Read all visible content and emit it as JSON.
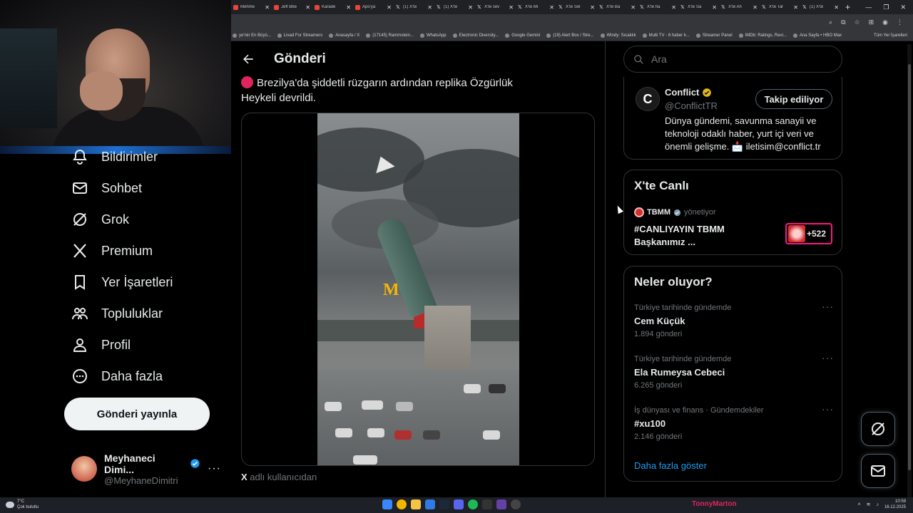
{
  "browser": {
    "tabs": [
      {
        "label": "Mehme",
        "icon": "youtube"
      },
      {
        "label": "Jeff Bbe",
        "icon": "youtube"
      },
      {
        "label": "Karade",
        "icon": "youtube"
      },
      {
        "label": "Apo'ya",
        "icon": "youtube"
      },
      {
        "label": "(1) X'te",
        "icon": "x"
      },
      {
        "label": "(1) X'te",
        "icon": "x"
      },
      {
        "label": "X'te sev",
        "icon": "x"
      },
      {
        "label": "X'te Mi",
        "icon": "x"
      },
      {
        "label": "X'te Sel",
        "icon": "x"
      },
      {
        "label": "X'te Ba",
        "icon": "x"
      },
      {
        "label": "X'te ha",
        "icon": "x"
      },
      {
        "label": "X'te Sa",
        "icon": "x"
      },
      {
        "label": "X'te Ah",
        "icon": "x"
      },
      {
        "label": "X'te Tar",
        "icon": "x"
      },
      {
        "label": "(1) X'te",
        "icon": "x"
      }
    ],
    "bookmarks": [
      "ye'nin En Büyü...",
      "Livad For Streamers",
      "Anasayfa / X",
      "(17145) Rammstein...",
      "WhatsApp",
      "Electronic Diversity...",
      "Google Gemini",
      "(19) Alert Box / Stre...",
      "Windy: Sıcaklık",
      "Multi TV - 6 haber k...",
      "Streamer Panel",
      "IMDb: Ratings, Revi...",
      "Ana Sayfa • HBO Max"
    ],
    "bookmarks_more": "Tüm Yer İşaretleri"
  },
  "nav": {
    "items": [
      {
        "label": "Bildirimler",
        "icon": "bell-icon"
      },
      {
        "label": "Sohbet",
        "icon": "mail-icon"
      },
      {
        "label": "Grok",
        "icon": "grok-icon"
      },
      {
        "label": "Premium",
        "icon": "x-logo-icon"
      },
      {
        "label": "Yer İşaretleri",
        "icon": "bookmark-icon"
      },
      {
        "label": "Topluluklar",
        "icon": "communities-icon"
      },
      {
        "label": "Profil",
        "icon": "person-icon"
      },
      {
        "label": "Daha fazla",
        "icon": "more-circle-icon"
      }
    ],
    "post_button": "Gönderi yayınla",
    "account": {
      "name": "Meyhaneci Dimi...",
      "handle": "@MeyhaneDimitri",
      "more": "···"
    }
  },
  "main": {
    "header_title": "Gönderi",
    "tweet_text": "Brezilya'da şiddetli rüzgarın ardından replika Özgürlük Heykeli devrildi.",
    "source_x": "X",
    "source_text": "adlı kullanıcıdan"
  },
  "right": {
    "search_placeholder": "Ara",
    "profile_card": {
      "name": "Conflict",
      "handle": "@ConflictTR",
      "follow_label": "Takip ediliyor",
      "bio": "Dünya gündemi, savunma sanayii ve teknoloji odaklı haber, yurt içi veri ve önemli gelişme. 📩 iletisim@conflict.tr",
      "avatar_letter": "C"
    },
    "live": {
      "title": "X'te Canlı",
      "host": "TBMM",
      "role": "yönetiyor",
      "stream_title": "#CANLIYAYIN TBMM Başkanımız ...",
      "listeners": "+522"
    },
    "trends": {
      "title": "Neler oluyor?",
      "items": [
        {
          "context": "Türkiye tarihinde gündemde",
          "name": "Cem Küçük",
          "count": "1.894 gönderi"
        },
        {
          "context": "Türkiye tarihinde gündemde",
          "name": "Ela Rumeysa Cebeci",
          "count": "6.265 gönderi"
        },
        {
          "context": "İş dünyası ve finans · Gündemdekiler",
          "name": "#xu100",
          "count": "2.146 gönderi"
        }
      ],
      "more_icon": "···",
      "show_more": "Daha fazla göster"
    }
  },
  "taskbar": {
    "weather_temp": "7°C",
    "weather_desc": "Çok bulutlu",
    "streamer": "TonnyMarton",
    "time": "10:59",
    "date": "16.12.2025"
  },
  "colors": {
    "accent_blue": "#1d9bf0",
    "live_pink": "#f91880",
    "tbmm_red": "#d32f2f",
    "background": "#000000"
  }
}
